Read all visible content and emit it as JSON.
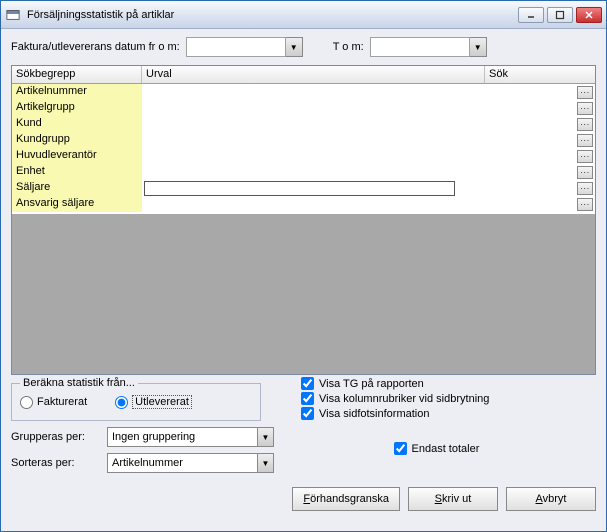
{
  "window": {
    "title": "Försäljningsstatistik på artiklar"
  },
  "dateRow": {
    "fromLabel": "Faktura/utlevererans datum fr o m:",
    "toLabel": "T o m:",
    "fromValue": "",
    "toValue": ""
  },
  "table": {
    "headers": {
      "c1": "Sökbegrepp",
      "c2": "Urval",
      "c3": "Sök"
    },
    "rows": [
      {
        "label": "Artikelnummer"
      },
      {
        "label": "Artikelgrupp"
      },
      {
        "label": "Kund"
      },
      {
        "label": "Kundgrupp"
      },
      {
        "label": "Huvudleverantör"
      },
      {
        "label": "Enhet"
      },
      {
        "label": "Säljare",
        "hasInput": true
      },
      {
        "label": "Ansvarig säljare"
      }
    ]
  },
  "groupbox": {
    "title": "Beräkna statistik från...",
    "opt1": "Fakturerat",
    "opt2": "Utlevererat"
  },
  "checks": {
    "tg": "Visa TG på rapporten",
    "col": "Visa kolumnrubriker vid sidbrytning",
    "footer": "Visa sidfotsinformation",
    "totals": "Endast totaler"
  },
  "groupBy": {
    "label": "Grupperas per:",
    "value": "Ingen gruppering"
  },
  "sortBy": {
    "label": "Sorteras per:",
    "value": "Artikelnummer"
  },
  "buttons": {
    "preview": "Förhandsgranska",
    "print": "Skriv ut",
    "cancel": "Avbryt"
  }
}
